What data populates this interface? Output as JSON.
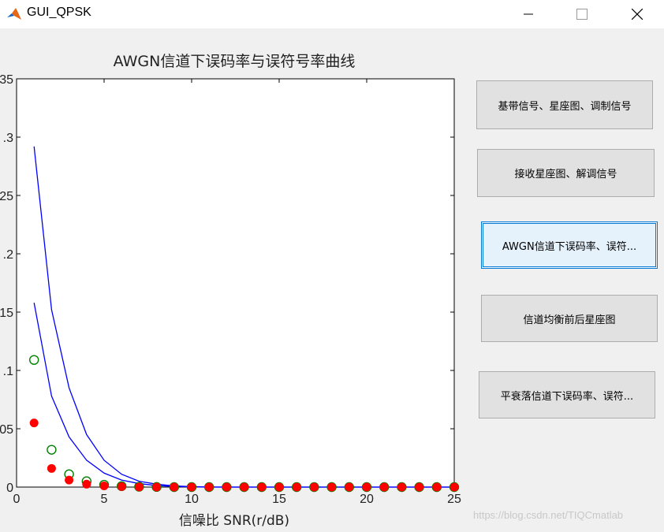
{
  "window": {
    "title": "GUI_QPSK",
    "colors": {
      "accent": "#0078d7",
      "titlebar": "#ffffff",
      "background": "#f0f0f0"
    },
    "icons": {
      "app": "matlab-icon",
      "minimize": "minimize-icon",
      "maximize": "maximize-icon",
      "close": "close-icon"
    }
  },
  "buttons": [
    {
      "label": "基带信号、星座图、调制信号"
    },
    {
      "label": "接收星座图、解调信号"
    },
    {
      "label": "AWGN信道下误码率、误符..."
    },
    {
      "label": "信道均衡前后星座图"
    },
    {
      "label": "平衰落信道下误码率、误符..."
    }
  ],
  "watermark": "https://blog.csdn.net/TIQCmatlab",
  "chart_data": {
    "type": "line",
    "title": "AWGN信道下误码率与误符号率曲线",
    "xlabel": "信噪比 SNR(r/dB)",
    "ylabel": "",
    "xlim": [
      0,
      25
    ],
    "ylim": [
      0,
      0.35
    ],
    "xticks": [
      "0",
      "5",
      "10",
      "15",
      "20",
      "25"
    ],
    "yticks": [
      "0",
      ".05",
      ".1",
      ".15",
      ".2",
      ".25",
      ".3",
      "35"
    ],
    "grid": false,
    "legend": "none",
    "x": [
      1,
      2,
      3,
      4,
      5,
      6,
      7,
      8,
      9,
      10,
      11,
      12,
      13,
      14,
      15,
      16,
      17,
      18,
      19,
      20,
      21,
      22,
      23,
      24,
      25
    ],
    "series": [
      {
        "style": "line",
        "color": "#0000ff",
        "values": [
          0.292,
          0.152,
          0.085,
          0.045,
          0.023,
          0.011,
          0.005,
          0.0025,
          0.001,
          0.0004,
          0.0001,
          0,
          0,
          0,
          0,
          0,
          0,
          0,
          0,
          0,
          0,
          0,
          0,
          0,
          0
        ]
      },
      {
        "style": "line",
        "color": "#0000ff",
        "values": [
          0.158,
          0.078,
          0.043,
          0.023,
          0.012,
          0.006,
          0.003,
          0.0013,
          0.0005,
          0.0002,
          0,
          0,
          0,
          0,
          0,
          0,
          0,
          0,
          0,
          0,
          0,
          0,
          0,
          0,
          0
        ]
      },
      {
        "style": "open-circle",
        "color": "#008000",
        "values": [
          0.109,
          0.032,
          0.011,
          0.005,
          0.002,
          0.0008,
          0.0003,
          0.0001,
          0,
          0,
          0,
          0,
          0,
          0,
          0,
          0,
          0,
          0,
          0,
          0,
          0,
          0,
          0,
          0,
          0
        ]
      },
      {
        "style": "filled-circle",
        "color": "#ff0000",
        "values": [
          0.055,
          0.016,
          0.006,
          0.0025,
          0.001,
          0.0004,
          0.0001,
          0,
          0,
          0,
          0,
          0,
          0,
          0,
          0,
          0,
          0,
          0,
          0,
          0,
          0,
          0,
          0,
          0,
          0
        ]
      }
    ]
  }
}
